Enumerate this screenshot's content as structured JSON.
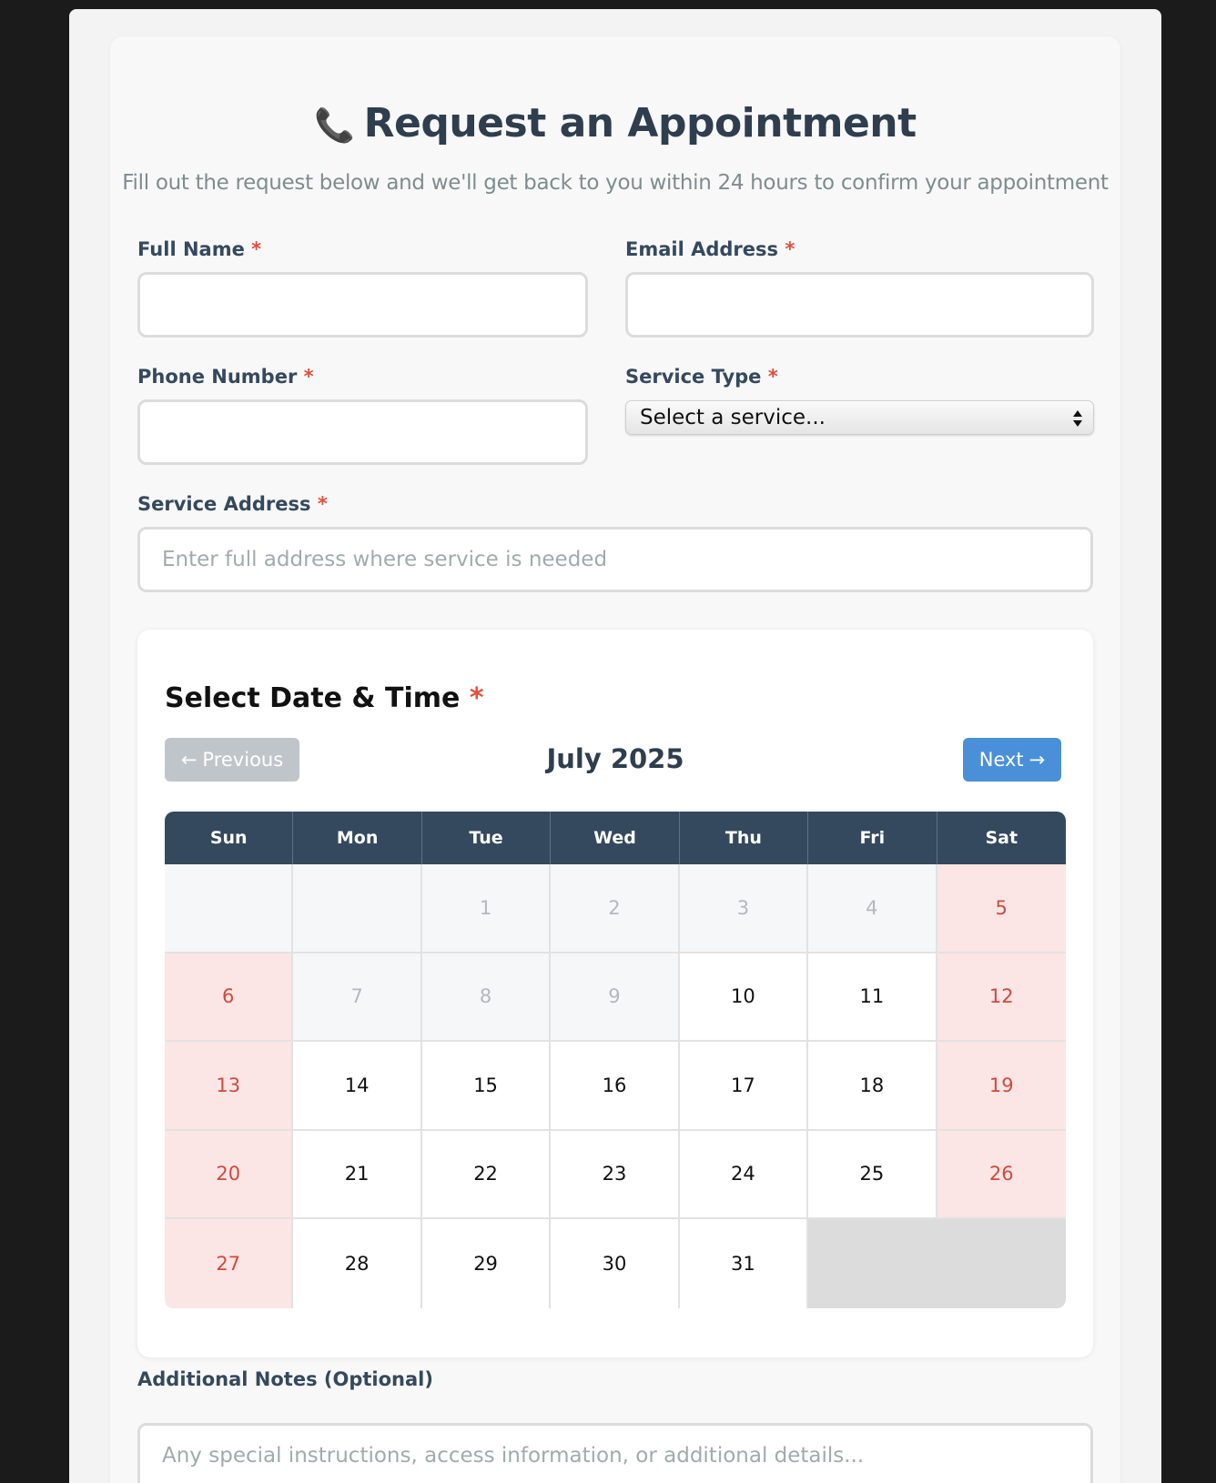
{
  "header": {
    "icon": "phone-icon",
    "title": "Request an Appointment",
    "subtitle": "Fill out the request below and we'll get back to you within 24 hours to confirm your appointment"
  },
  "form": {
    "full_name": {
      "label": "Full Name",
      "value": "",
      "placeholder": ""
    },
    "email": {
      "label": "Email Address",
      "value": "",
      "placeholder": ""
    },
    "phone": {
      "label": "Phone Number",
      "value": "",
      "placeholder": ""
    },
    "service_type": {
      "label": "Service Type",
      "selected": "Select a service..."
    },
    "address": {
      "label": "Service Address",
      "value": "",
      "placeholder": "Enter full address where service is needed"
    },
    "required_mark": "*"
  },
  "calendar": {
    "title": "Select Date & Time",
    "prev_label": "Previous",
    "next_label": "Next",
    "month": "July 2025",
    "weekdays": [
      "Sun",
      "Mon",
      "Tue",
      "Wed",
      "Thu",
      "Fri",
      "Sat"
    ],
    "weeks": [
      [
        {
          "d": "",
          "s": "empty"
        },
        {
          "d": "",
          "s": "empty"
        },
        {
          "d": "1",
          "s": "past"
        },
        {
          "d": "2",
          "s": "past"
        },
        {
          "d": "3",
          "s": "past"
        },
        {
          "d": "4",
          "s": "past"
        },
        {
          "d": "5",
          "s": "weekend"
        }
      ],
      [
        {
          "d": "6",
          "s": "weekend"
        },
        {
          "d": "7",
          "s": "past"
        },
        {
          "d": "8",
          "s": "past"
        },
        {
          "d": "9",
          "s": "past"
        },
        {
          "d": "10",
          "s": "available"
        },
        {
          "d": "11",
          "s": "available"
        },
        {
          "d": "12",
          "s": "weekend"
        }
      ],
      [
        {
          "d": "13",
          "s": "weekend"
        },
        {
          "d": "14",
          "s": "available"
        },
        {
          "d": "15",
          "s": "available"
        },
        {
          "d": "16",
          "s": "available"
        },
        {
          "d": "17",
          "s": "available"
        },
        {
          "d": "18",
          "s": "available"
        },
        {
          "d": "19",
          "s": "weekend"
        }
      ],
      [
        {
          "d": "20",
          "s": "weekend"
        },
        {
          "d": "21",
          "s": "available"
        },
        {
          "d": "22",
          "s": "available"
        },
        {
          "d": "23",
          "s": "available"
        },
        {
          "d": "24",
          "s": "available"
        },
        {
          "d": "25",
          "s": "available"
        },
        {
          "d": "26",
          "s": "weekend"
        }
      ],
      [
        {
          "d": "27",
          "s": "weekend"
        },
        {
          "d": "28",
          "s": "available"
        },
        {
          "d": "29",
          "s": "available"
        },
        {
          "d": "30",
          "s": "available"
        },
        {
          "d": "31",
          "s": "available"
        },
        {
          "d": "",
          "s": "blank"
        },
        {
          "d": "",
          "s": "blank"
        }
      ]
    ]
  },
  "notes": {
    "label": "Additional Notes (Optional)",
    "placeholder": "Any special instructions, access information, or additional details..."
  },
  "colors": {
    "accent": "#4a90d9",
    "header_bg": "#34495e",
    "required": "#e74c3c",
    "weekend_bg": "#fbe5e5"
  }
}
